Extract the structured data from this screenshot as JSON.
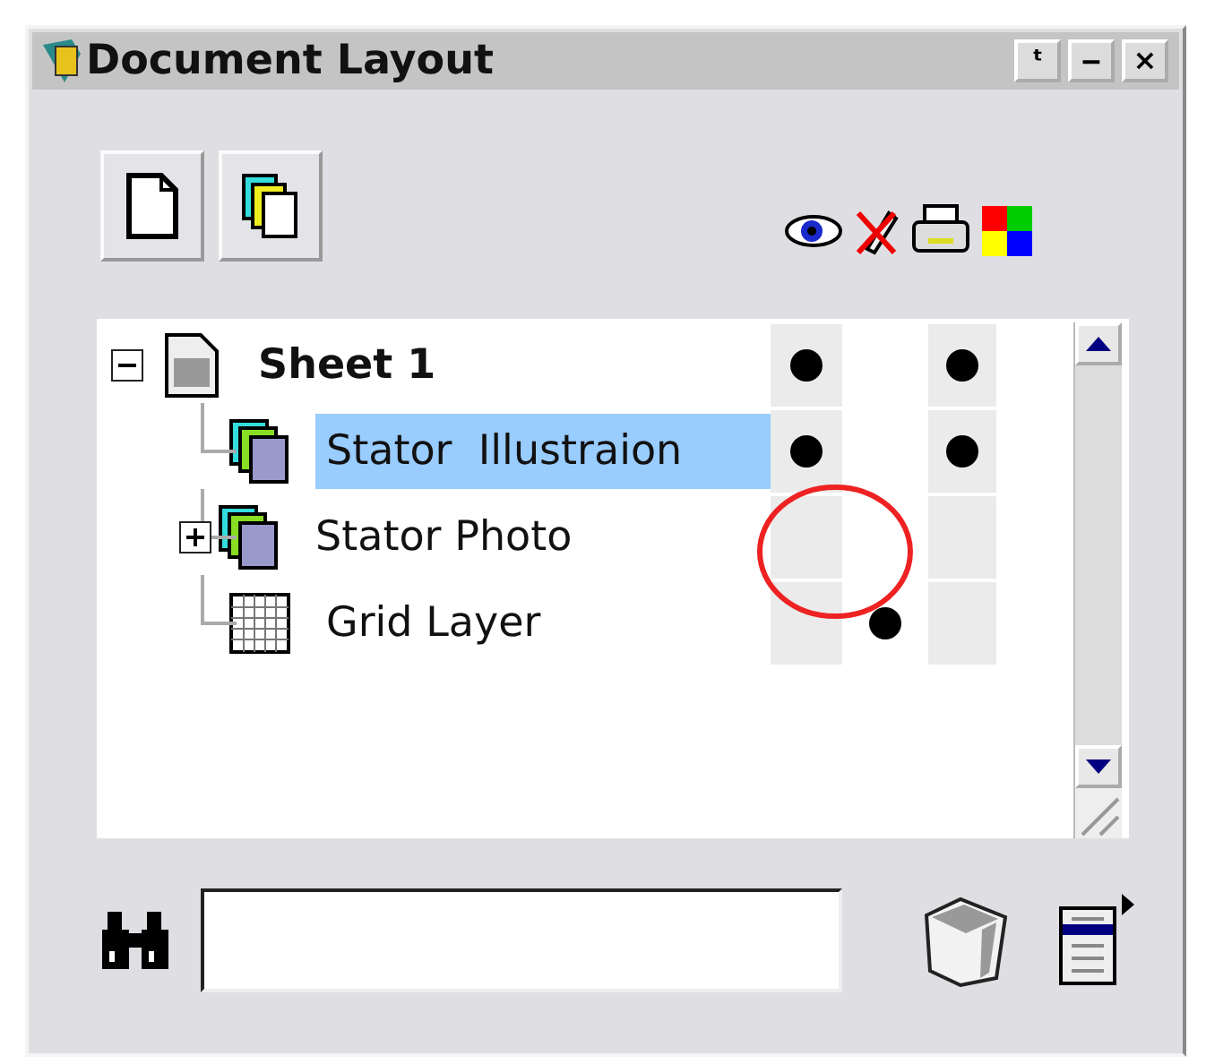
{
  "window": {
    "title": "Document Layout"
  },
  "title_buttons": [
    "ᵗ",
    "‒",
    "×"
  ],
  "tree": [
    {
      "name": "Sheet 1",
      "kind": "sheet",
      "expanded": true,
      "selected": false,
      "visible": true,
      "locked": false,
      "printable": true,
      "children": [
        {
          "name": "Stator  Illustraion",
          "kind": "layer",
          "selected": true,
          "visible": true,
          "locked": false,
          "printable": true
        },
        {
          "name": "Stator Photo",
          "kind": "layer",
          "expanded": false,
          "selected": false,
          "visible": false,
          "locked": false,
          "printable": false
        },
        {
          "name": "Grid Layer",
          "kind": "grid",
          "selected": false,
          "visible": false,
          "locked": true,
          "printable": false
        }
      ]
    }
  ]
}
